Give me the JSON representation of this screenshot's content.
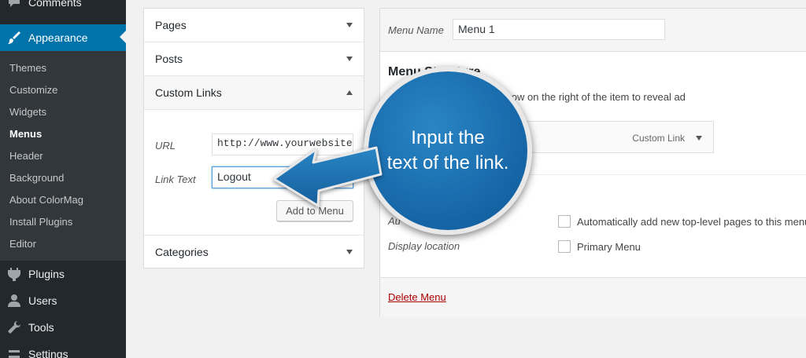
{
  "sidebar": {
    "top_items": [
      {
        "label": "Comments",
        "icon": "comment-icon"
      },
      {
        "label": "Appearance",
        "icon": "paintbrush-icon"
      }
    ],
    "submenu": [
      "Themes",
      "Customize",
      "Widgets",
      "Menus",
      "Header",
      "Background",
      "About ColorMag",
      "Install Plugins",
      "Editor"
    ],
    "current_submenu": "Menus",
    "bottom_items": [
      {
        "label": "Plugins",
        "icon": "plugin-icon"
      },
      {
        "label": "Users",
        "icon": "user-icon"
      },
      {
        "label": "Tools",
        "icon": "wrench-icon"
      },
      {
        "label": "Settings",
        "icon": "settings-icon"
      }
    ],
    "colors": {
      "bg": "#23282d",
      "active": "#0073aa"
    }
  },
  "accordion": {
    "sections": {
      "pages": "Pages",
      "posts": "Posts",
      "custom_links": "Custom Links",
      "categories": "Categories"
    },
    "url_label": "URL",
    "url_value": "http://www.yourwebsite",
    "link_text_label": "Link Text",
    "link_text_value": "Logout",
    "add_button": "Add to Menu"
  },
  "editor": {
    "menu_name_label": "Menu Name",
    "menu_name_value": "Menu 1",
    "structure_title": "Menu Structure",
    "structure_desc": "der you prefer. Click the arrow on the right of the item to reveal ad",
    "menu_item_type": "Custom Link",
    "auto_add_label": "Au",
    "auto_add_text": "Automatically add new top-level pages to this menu",
    "display_location_label": "Display location",
    "primary_menu_text": "Primary Menu",
    "delete_link": "Delete Menu"
  },
  "callout": {
    "line1": "Input the",
    "line2": "text of the link."
  }
}
